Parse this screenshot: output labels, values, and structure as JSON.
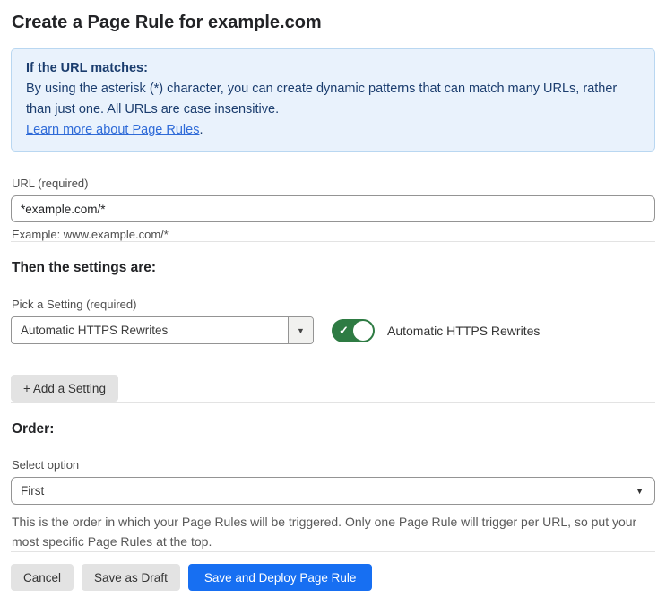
{
  "page": {
    "title": "Create a Page Rule for example.com"
  },
  "info_box": {
    "heading": "If the URL matches:",
    "body": "By using the asterisk (*) character, you can create dynamic patterns that can match many URLs, rather than just one. All URLs are case insensitive.",
    "link_label": "Learn more about Page Rules",
    "link_suffix": "."
  },
  "url_field": {
    "label": "URL (required)",
    "value": "*example.com/*",
    "helper": "Example: www.example.com/*"
  },
  "settings": {
    "heading": "Then the settings are:",
    "picker_label": "Pick a Setting (required)",
    "selected_setting": "Automatic HTTPS Rewrites",
    "toggle": {
      "state": "on",
      "label": "Automatic HTTPS Rewrites"
    },
    "add_button_label": "+ Add a Setting"
  },
  "order": {
    "heading": "Order:",
    "select_label": "Select option",
    "selected_option": "First",
    "helper": "This is the order in which your Page Rules will be triggered. Only one Page Rule will trigger per URL, so put your most specific Page Rules at the top."
  },
  "footer": {
    "cancel_label": "Cancel",
    "save_draft_label": "Save as Draft",
    "save_deploy_label": "Save and Deploy Page Rule"
  },
  "icons": {
    "dropdown_arrow": "▼",
    "check": "✓"
  },
  "colors": {
    "info_bg": "#e9f2fc",
    "info_border": "#b9d7f1",
    "info_text": "#1b3d6e",
    "link_blue": "#2f6bd8",
    "toggle_green": "#2e7b43",
    "primary_blue": "#176ff2"
  }
}
